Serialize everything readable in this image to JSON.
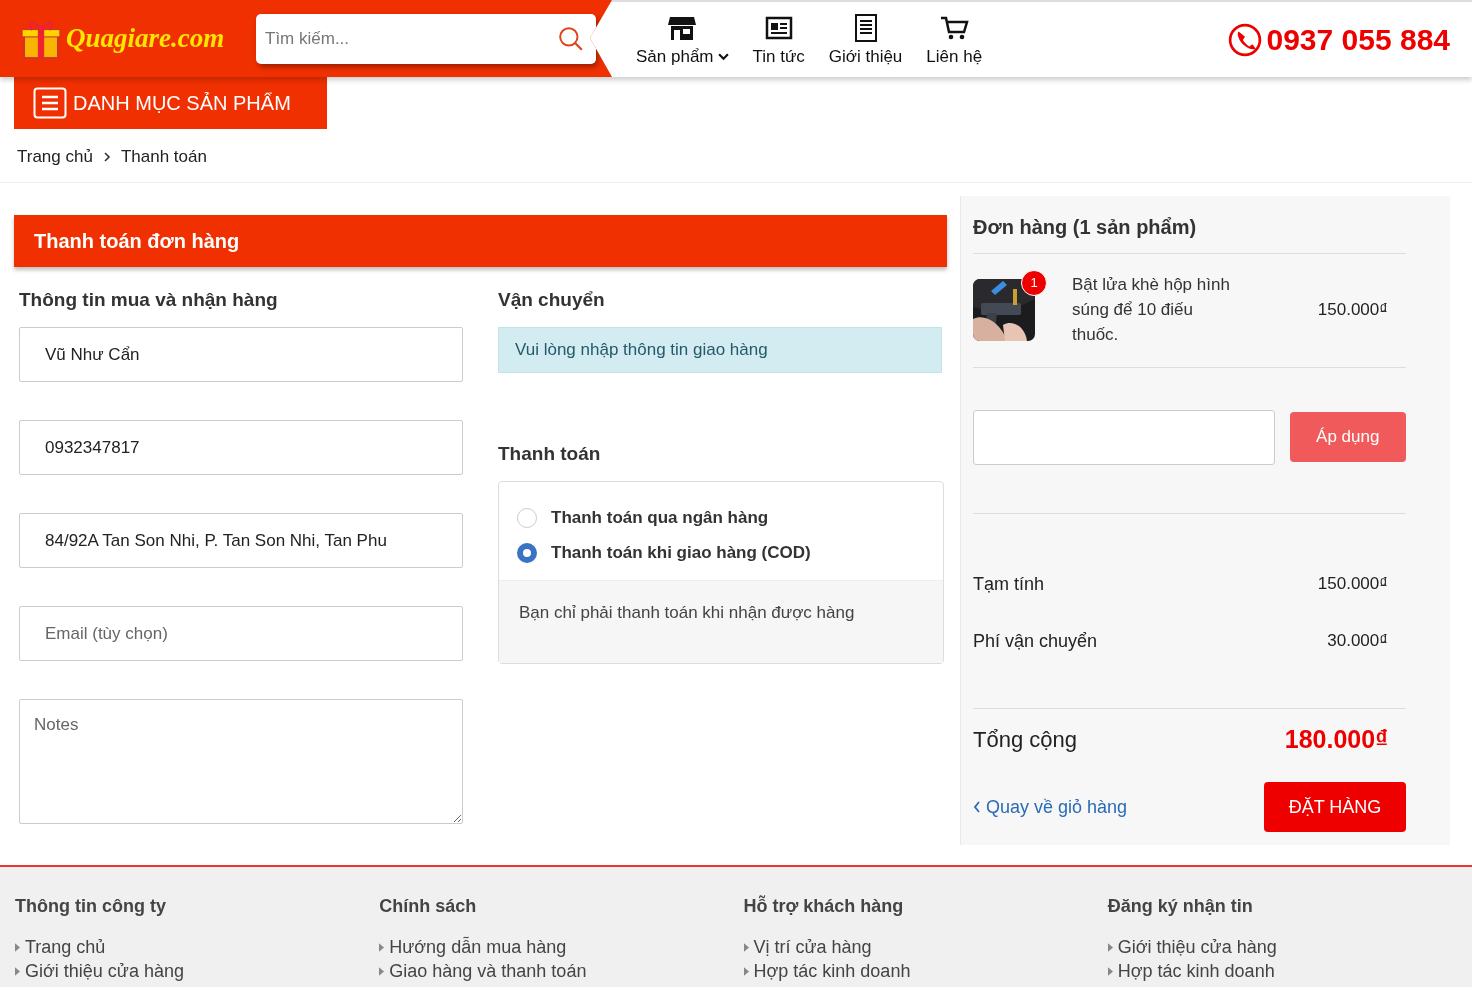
{
  "header": {
    "logo": "Quagiare.com",
    "search": {
      "placeholder": "Tìm kiếm..."
    },
    "nav": [
      {
        "label": "Sản phẩm",
        "kind": "store",
        "dropdown": true
      },
      {
        "label": "Tin tức",
        "kind": "news",
        "dropdown": false
      },
      {
        "label": "Giới thiệu",
        "kind": "document",
        "dropdown": false
      },
      {
        "label": "Liên hệ",
        "kind": "cart",
        "dropdown": false
      }
    ],
    "phone": "0937 055 884"
  },
  "category_button": "DANH MỤC SẢN PHẨM",
  "breadcrumb": [
    "Trang chủ",
    "Thanh toán"
  ],
  "checkout": {
    "title": "Thanh toán đơn hàng",
    "buyer": {
      "heading": "Thông tin mua và nhận hàng",
      "fields": [
        {
          "kind": "input",
          "value": "Vũ Như Cẩn"
        },
        {
          "kind": "input",
          "value": "0932347817"
        },
        {
          "kind": "input",
          "value": "84/92A Tan Son Nhi, P. Tan Son Nhi, Tan Phu"
        },
        {
          "kind": "input",
          "placeholder": "Email (tùy chọn)"
        },
        {
          "kind": "textarea",
          "placeholder": "Notes"
        }
      ]
    },
    "shipping": {
      "heading": "Vận chuyển",
      "notice": "Vui lòng nhập thông tin giao hàng"
    },
    "payment": {
      "heading": "Thanh toán",
      "options": [
        {
          "label": "Thanh toán qua ngân hàng",
          "selected": false
        },
        {
          "label": "Thanh toán khi giao hàng (COD)",
          "selected": true
        }
      ],
      "description": "Bạn chỉ phải thanh toán khi nhận được hàng"
    }
  },
  "order": {
    "title": "Đơn hàng (1 sản phẩm)",
    "items": [
      {
        "kind": "picture",
        "quantity": "1",
        "name": "Bật lửa khè hộp hình súng để 10 điếu thuốc.",
        "price": "150.000₫"
      }
    ],
    "coupon_button": "Áp dụng",
    "subtotal": {
      "label": "Tạm tính",
      "value": "150.000₫"
    },
    "shipping_fee": {
      "label": "Phí vận chuyển",
      "value": "30.000₫"
    },
    "total": {
      "label": "Tổng cộng",
      "value": "180.000₫"
    },
    "back_link": "Quay về giỏ hàng",
    "place_order": "ĐẶT HÀNG"
  },
  "footer": [
    {
      "heading": "Thông tin công ty",
      "links": [
        "Trang chủ",
        "Giới thiệu cửa hàng"
      ]
    },
    {
      "heading": "Chính sách",
      "links": [
        "Hướng dẫn mua hàng",
        "Giao hàng và thanh toán"
      ]
    },
    {
      "heading": "Hỗ trợ khách hàng",
      "links": [
        "Vị trí cửa hàng",
        "Hợp tác kinh doanh"
      ]
    },
    {
      "heading": "Đăng ký nhận tin",
      "links": [
        "Giới thiệu cửa hàng",
        "Hợp tác kinh doanh"
      ]
    }
  ]
}
